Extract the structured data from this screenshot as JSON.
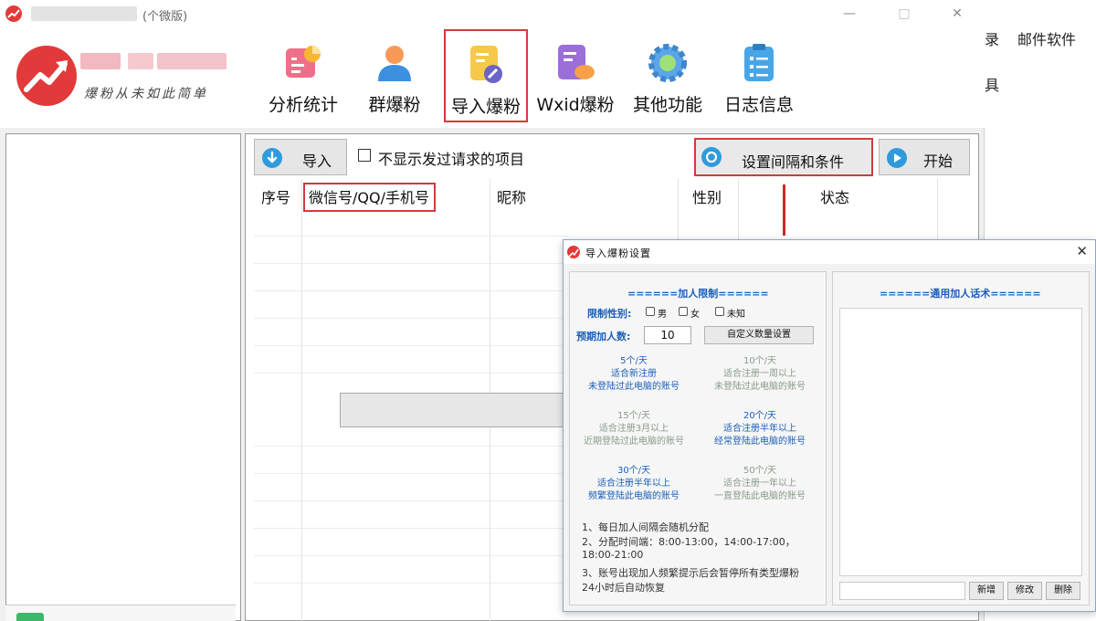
{
  "window": {
    "title_suffix": "(个微版)",
    "minimize": "—",
    "maximize": "□",
    "close": "✕"
  },
  "logo": {
    "slogan": "爆粉从未如此简单"
  },
  "toolbar": [
    {
      "label": "分析统计",
      "icon": "chart-icon"
    },
    {
      "label": "群爆粉",
      "icon": "person-icon"
    },
    {
      "label": "导入爆粉",
      "icon": "import-icon",
      "active": true
    },
    {
      "label": "Wxid爆粉",
      "icon": "chat-icon"
    },
    {
      "label": "其他功能",
      "icon": "gear-icon"
    },
    {
      "label": "日志信息",
      "icon": "clipboard-icon"
    }
  ],
  "content": {
    "import_button": "导入",
    "hide_sent_label": "不显示发过请求的项目",
    "settings_button": "设置间隔和条件",
    "start_button": "开始",
    "columns": [
      "序号",
      "微信号/QQ/手机号",
      "昵称",
      "性别",
      "状态"
    ]
  },
  "side_text": {
    "line1_a": "录",
    "line1_b": "邮件软件",
    "line2": "具"
  },
  "dialog": {
    "title": "导入爆粉设置",
    "close": "✕",
    "left_section_title": "======加人限制======",
    "gender_label": "限制性别:",
    "gender_options": [
      "男",
      "女",
      "未知"
    ],
    "expected_label": "预期加人数:",
    "expected_value": "10",
    "custom_button": "自定义数量设置",
    "tiers": [
      {
        "rate": "5个/天",
        "line1": "适合新注册",
        "line2": "未登陆过此电脑的账号",
        "style": "blue"
      },
      {
        "rate": "10个/天",
        "line1": "适合注册一周以上",
        "line2": "未登陆过此电脑的账号",
        "style": "gray"
      },
      {
        "rate": "15个/天",
        "line1": "适合注册3月以上",
        "line2": "近期登陆过此电脑的账号",
        "style": "gray"
      },
      {
        "rate": "20个/天",
        "line1": "适合注册半年以上",
        "line2": "经常登陆此电脑的账号",
        "style": "blue"
      },
      {
        "rate": "30个/天",
        "line1": "适合注册半年以上",
        "line2": "频繁登陆此电脑的账号",
        "style": "blue"
      },
      {
        "rate": "50个/天",
        "line1": "适合注册一年以上",
        "line2": "一直登陆此电脑的账号",
        "style": "gray"
      }
    ],
    "notes": [
      "1、每日加人间隔会随机分配",
      "2、分配时间端：8:00-13:00，14:00-17:00，",
      "18:00-21:00",
      "3、账号出现加人频繁提示后会暂停所有类型爆粉",
      "24小时后自动恢复"
    ],
    "right_section_title": "======通用加人话术======",
    "add_button": "新增",
    "edit_button": "修改",
    "delete_button": "删除"
  },
  "colors": {
    "brand_red": "#e23a3a",
    "highlight_red": "#d23b3b",
    "dialog_blue": "#1c5fb8"
  }
}
